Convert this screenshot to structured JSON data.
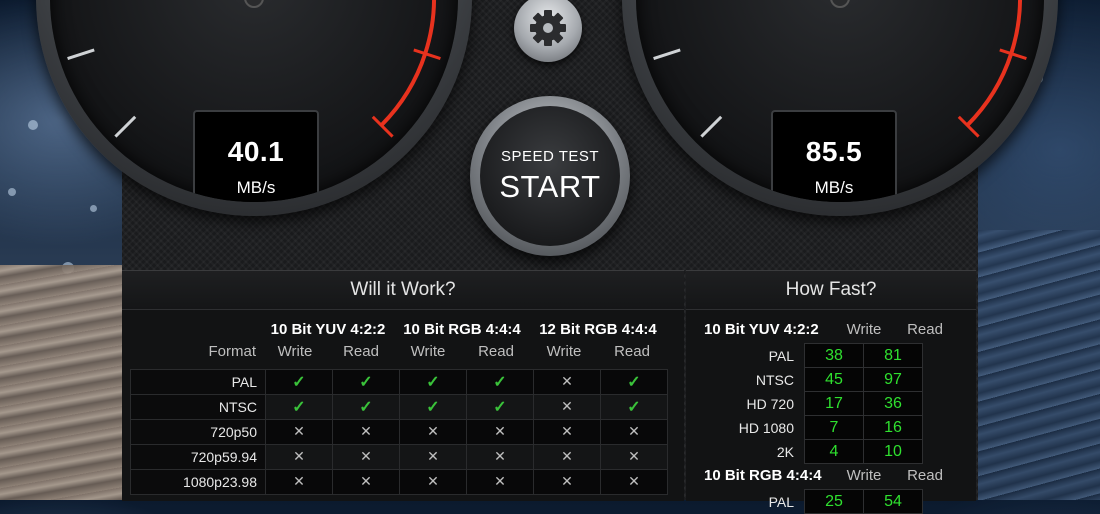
{
  "gauges": {
    "write": {
      "value": "40.1",
      "unit": "MB/s",
      "needle_fraction": 0.4
    },
    "read": {
      "value": "85.5",
      "unit": "MB/s",
      "needle_fraction": 0.62
    }
  },
  "start_button": {
    "line1": "SPEED TEST",
    "line2": "START"
  },
  "icons": {
    "settings": "gear-icon",
    "check": "check-icon",
    "cross": "cross-icon"
  },
  "colors": {
    "needle": "#1eb6ef",
    "redline": "#e8321e",
    "ok": "#3ac23a",
    "speed_value": "#2fe02f"
  },
  "will_it_work": {
    "title": "Will it Work?",
    "format_label": "Format",
    "groups": [
      {
        "name": "10 Bit YUV 4:2:2",
        "write": "Write",
        "read": "Read"
      },
      {
        "name": "10 Bit RGB 4:4:4",
        "write": "Write",
        "read": "Read"
      },
      {
        "name": "12 Bit RGB 4:4:4",
        "write": "Write",
        "read": "Read"
      }
    ],
    "rows": [
      {
        "format": "PAL",
        "cells": [
          "✓",
          "✓",
          "✓",
          "✓",
          "✕",
          "✓"
        ]
      },
      {
        "format": "NTSC",
        "cells": [
          "✓",
          "✓",
          "✓",
          "✓",
          "✕",
          "✓"
        ]
      },
      {
        "format": "720p50",
        "cells": [
          "✕",
          "✕",
          "✕",
          "✕",
          "✕",
          "✕"
        ]
      },
      {
        "format": "720p59.94",
        "cells": [
          "✕",
          "✕",
          "✕",
          "✕",
          "✕",
          "✕"
        ]
      },
      {
        "format": "1080p23.98",
        "cells": [
          "✕",
          "✕",
          "✕",
          "✕",
          "✕",
          "✕"
        ]
      }
    ]
  },
  "how_fast": {
    "title": "How Fast?",
    "groups": [
      {
        "name": "10 Bit YUV 4:2:2",
        "write": "Write",
        "read": "Read",
        "rows": [
          {
            "format": "PAL",
            "write": "38",
            "read": "81"
          },
          {
            "format": "NTSC",
            "write": "45",
            "read": "97"
          },
          {
            "format": "HD 720",
            "write": "17",
            "read": "36"
          },
          {
            "format": "HD 1080",
            "write": "7",
            "read": "16"
          },
          {
            "format": "2K",
            "write": "4",
            "read": "10"
          }
        ]
      },
      {
        "name": "10 Bit RGB 4:4:4",
        "write": "Write",
        "read": "Read",
        "rows": [
          {
            "format": "PAL",
            "write": "25",
            "read": "54"
          }
        ]
      }
    ]
  }
}
